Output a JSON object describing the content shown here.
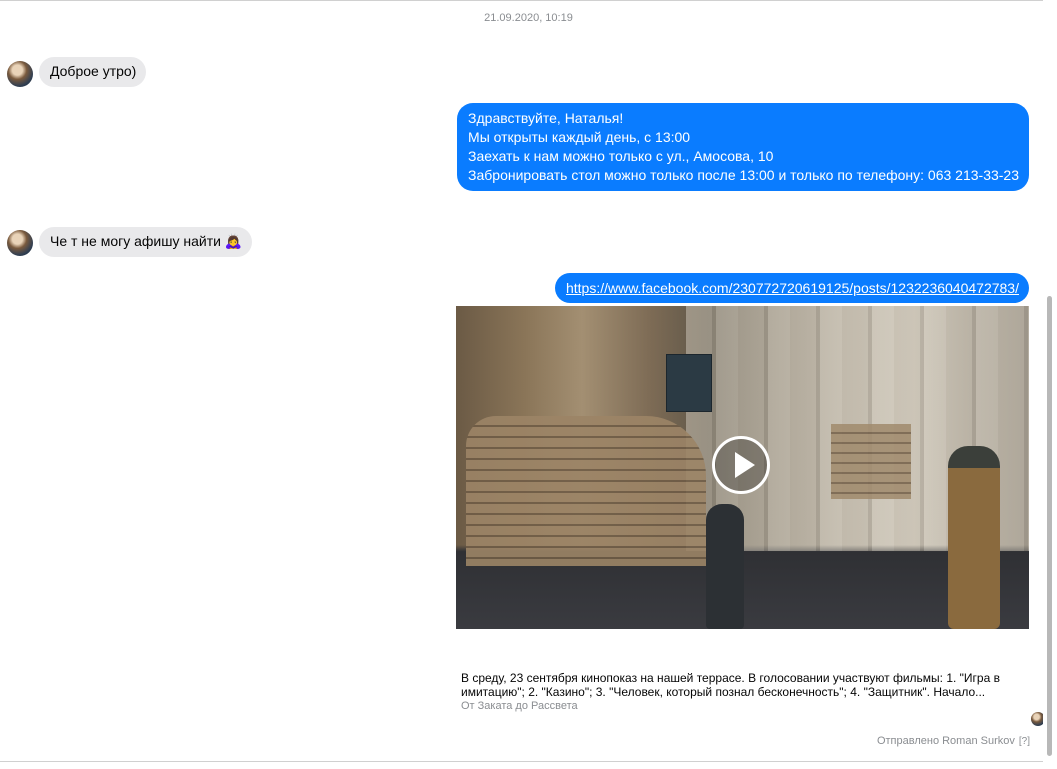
{
  "conversation": {
    "timestamp": "21.09.2020, 10:19",
    "messages": {
      "m1": {
        "from": "contact",
        "text": "Доброе утро)"
      },
      "m2": {
        "from": "page",
        "lines": [
          "Здравствуйте, Наталья!",
          "Мы открыты каждый день, с 13:00",
          "Заехать к нам можно только с ул., Амосова, 10",
          "Забронировать стол можно только после 13:00 и только по телефону: 063 213-33-23"
        ]
      },
      "m3": {
        "from": "contact",
        "text": "Че т не могу афишу найти 🙇‍♀️"
      },
      "m4": {
        "from": "page",
        "link": "https://www.facebook.com/230772720619125/posts/1232236040472783/"
      }
    },
    "preview": {
      "description": "В среду, 23 сентября кинопоказ на нашей террасе. В голосовании участвуют фильмы: 1. \"Игра в имитацию\"; 2. \"Казино\"; 3. \"Человек, который познал бесконечность\"; 4. \"Защитник\". Начало...",
      "source": "От Заката до Рассвета"
    },
    "sent_by": "Отправлено Roman Surkov",
    "sent_by_help": "[?]"
  },
  "colors": {
    "outgoing_bubble": "#0a7cff",
    "incoming_bubble": "#e9e9eb",
    "muted_text": "#8a8d91"
  },
  "icons": {
    "play": "play-icon",
    "avatar": "contact-avatar"
  }
}
